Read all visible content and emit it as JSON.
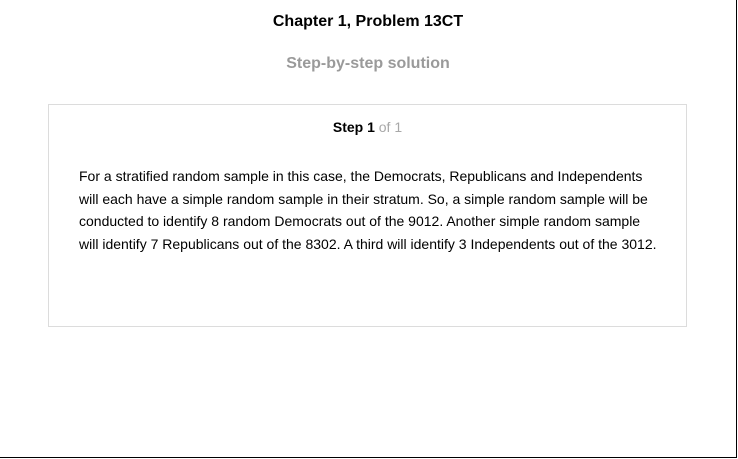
{
  "header": {
    "chapter_title": "Chapter 1, Problem 13CT",
    "subtitle": "Step-by-step solution"
  },
  "step": {
    "label": "Step 1",
    "of_total": "of 1",
    "body": "For a stratified random sample in this case, the Democrats, Republicans and Independents will each have a simple random sample in their stratum. So, a simple random sample will be conducted to identify 8 random Democrats out of the 9012. Another simple random sample will identify 7 Republicans out of the 8302. A third will identify 3 Independents out of the 3012."
  },
  "colors": {
    "subtitle": "#9a9a9a",
    "step_of": "#a8a8a8",
    "card_border": "#dcdcdc"
  }
}
